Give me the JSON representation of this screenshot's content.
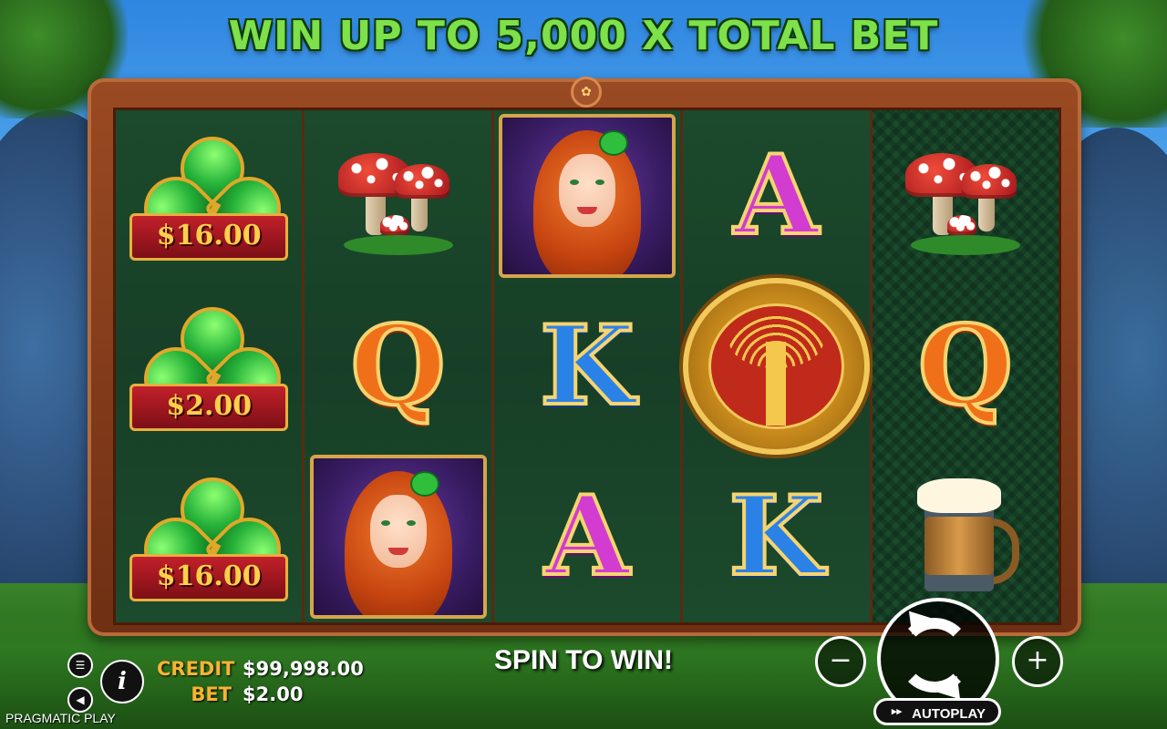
{
  "game": {
    "title": "WIN UP TO 5,000 X TOTAL BET",
    "message": "SPIN TO WIN!",
    "brand": "PRAGMATIC PLAY"
  },
  "reels": [
    {
      "symbols": [
        {
          "type": "clover-cash",
          "value": "$16.00"
        },
        {
          "type": "clover-cash",
          "value": "$2.00"
        },
        {
          "type": "clover-cash",
          "value": "$16.00"
        }
      ]
    },
    {
      "symbols": [
        {
          "type": "mushrooms"
        },
        {
          "type": "Q"
        },
        {
          "type": "red-haired-lady"
        }
      ]
    },
    {
      "symbols": [
        {
          "type": "red-haired-lady"
        },
        {
          "type": "K"
        },
        {
          "type": "A"
        }
      ]
    },
    {
      "symbols": [
        {
          "type": "A"
        },
        {
          "type": "tree-of-life"
        },
        {
          "type": "K"
        }
      ]
    },
    {
      "symbols": [
        {
          "type": "mushrooms"
        },
        {
          "type": "Q"
        },
        {
          "type": "beer-mug"
        }
      ]
    }
  ],
  "hud": {
    "credit_label": "CREDIT",
    "credit_value": "$99,998.00",
    "bet_label": "BET",
    "bet_value": "$2.00",
    "info_label": "i",
    "minus_label": "−",
    "plus_label": "+",
    "autoplay_label": "AUTOPLAY"
  },
  "icons": [
    "menu-icon",
    "sound-icon",
    "info-icon",
    "minus-icon",
    "spin-icon",
    "plus-icon",
    "autoplay-icon"
  ]
}
